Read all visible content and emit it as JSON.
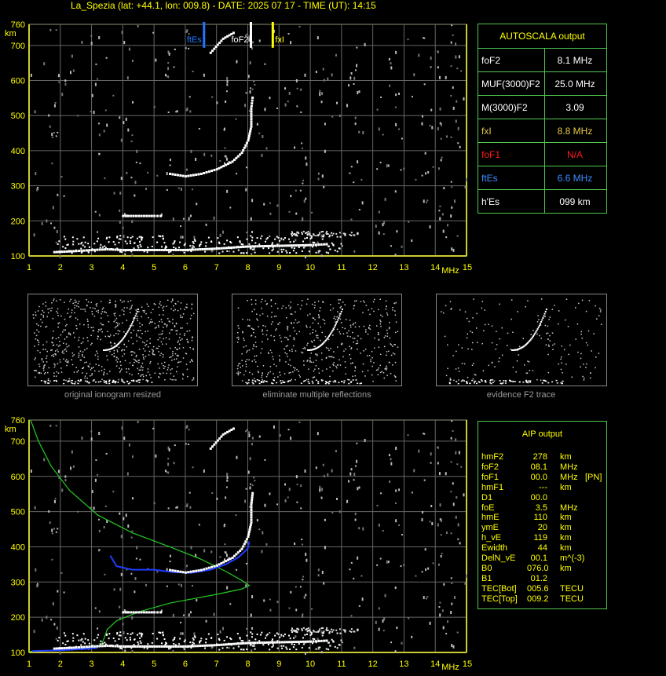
{
  "header": "La_Spezia (lat: +44.1, lon: 009.8) - DATE: 2025 07 17 - TIME (UT): 14:15",
  "axes": {
    "y_unit": "km",
    "x_unit": "MHz",
    "y_ticks": [
      "760",
      "700",
      "600",
      "500",
      "400",
      "300",
      "200",
      "100"
    ],
    "x_ticks": [
      "1",
      "2",
      "3",
      "4",
      "5",
      "6",
      "7",
      "8",
      "9",
      "10",
      "11",
      "12",
      "13",
      "14",
      "15"
    ]
  },
  "markers": {
    "ftEs_label": "ftEs",
    "foF2_label": "foF2",
    "fxI_label": "fxI",
    "colors": {
      "ftEs": "#1e78ff",
      "foF2": "#ffffff",
      "fxI": "#ffff00"
    }
  },
  "autoscala": {
    "title": "AUTOSCALA output",
    "rows": [
      {
        "label": "foF2",
        "value": "8.1 MHz",
        "color": "#ffffff"
      },
      {
        "label": "MUF(3000)F2",
        "value": "25.0 MHz",
        "color": "#ffffff"
      },
      {
        "label": "M(3000)F2",
        "value": "3.09",
        "color": "#ffffff"
      },
      {
        "label": "fxI",
        "value": "8.8 MHz",
        "color": "#e6c84a"
      },
      {
        "label": "foF1",
        "value": "N/A",
        "color": "#ff1a1a"
      },
      {
        "label": "ftEs",
        "value": "6.6 MHz",
        "color": "#3c8cff"
      },
      {
        "label": "h'Es",
        "value": "099      km",
        "color": "#ffffff"
      }
    ]
  },
  "thumbnails": {
    "captions": [
      "original ionogram resized",
      "eliminate multiple reflections",
      "evidence F2 trace"
    ]
  },
  "aip": {
    "title": "AIP output",
    "rows": [
      [
        "hmF2",
        "278",
        "km",
        ""
      ],
      [
        "foF2",
        "08.1",
        "MHz",
        ""
      ],
      [
        "foF1",
        "00.0",
        "MHz",
        "[PN]"
      ],
      [
        "hmF1",
        "---",
        "km",
        ""
      ],
      [
        "D1",
        "00.0",
        "",
        ""
      ],
      [
        "foE",
        "3.5",
        "MHz",
        ""
      ],
      [
        "hmE",
        "110",
        "km",
        ""
      ],
      [
        "ymE",
        "20",
        "km",
        ""
      ],
      [
        "h_vE",
        "119",
        "km",
        ""
      ],
      [
        "Ewidth",
        "44",
        "km",
        ""
      ],
      [
        "DelN_vE",
        "00.1",
        "m^(-3)",
        ""
      ],
      [
        "B0",
        "076.0",
        "km",
        ""
      ],
      [
        "B1",
        "01.2",
        "",
        ""
      ],
      [
        "TEC[Bot]",
        "005.6",
        "TECU",
        ""
      ],
      [
        "TEC[Top]",
        "009.2",
        "TECU",
        ""
      ]
    ]
  },
  "chart_data": [
    {
      "type": "scatter",
      "title": "",
      "xlabel": "MHz",
      "ylabel": "km",
      "xlim": [
        1,
        15
      ],
      "ylim": [
        100,
        760
      ],
      "grid": true,
      "series": [
        {
          "name": "F2 trace",
          "points": [
            [
              5.5,
              335
            ],
            [
              6.0,
              328
            ],
            [
              6.5,
              335
            ],
            [
              7.0,
              348
            ],
            [
              7.5,
              370
            ],
            [
              7.8,
              395
            ],
            [
              8.0,
              430
            ],
            [
              8.1,
              470
            ],
            [
              8.1,
              520
            ],
            [
              8.15,
              560
            ]
          ]
        },
        {
          "name": "F2 x-trace",
          "points": [
            [
              6.8,
              680
            ],
            [
              7.2,
              720
            ],
            [
              7.6,
              740
            ]
          ]
        },
        {
          "name": "Es trace",
          "points": [
            [
              1.8,
              112
            ],
            [
              2.5,
              115
            ],
            [
              3.0,
              118
            ],
            [
              3.5,
              120
            ],
            [
              4.0,
              118
            ],
            [
              5.0,
              118
            ],
            [
              6.0,
              118
            ],
            [
              7.0,
              122
            ],
            [
              8.0,
              128
            ],
            [
              9.0,
              130
            ],
            [
              10.0,
              132
            ],
            [
              10.6,
              135
            ]
          ]
        },
        {
          "name": "E layer echo",
          "points": [
            [
              4.0,
              215
            ],
            [
              4.5,
              215
            ],
            [
              5.0,
              215
            ],
            [
              5.3,
              215
            ]
          ]
        }
      ],
      "vlines": [
        {
          "name": "ftEs",
          "x": 6.6
        },
        {
          "name": "foF2",
          "x": 8.1
        },
        {
          "name": "fxI",
          "x": 8.8
        }
      ]
    },
    {
      "type": "line",
      "title": "",
      "xlabel": "MHz",
      "ylabel": "km",
      "xlim": [
        1,
        15
      ],
      "ylim": [
        100,
        760
      ],
      "grid": true,
      "series": [
        {
          "name": "electron density profile",
          "color": "#22cc22",
          "points": [
            [
              1.05,
              760
            ],
            [
              1.3,
              700
            ],
            [
              1.7,
              630
            ],
            [
              2.3,
              560
            ],
            [
              3.2,
              490
            ],
            [
              4.3,
              440
            ],
            [
              5.5,
              400
            ],
            [
              6.5,
              365
            ],
            [
              7.3,
              330
            ],
            [
              7.8,
              305
            ],
            [
              8.05,
              290
            ],
            [
              7.8,
              280
            ],
            [
              7.0,
              265
            ],
            [
              5.5,
              240
            ],
            [
              4.5,
              215
            ],
            [
              3.8,
              190
            ],
            [
              3.5,
              165
            ],
            [
              3.4,
              140
            ],
            [
              3.3,
              120
            ],
            [
              3.0,
              112
            ],
            [
              2.0,
              106
            ],
            [
              1.0,
              103
            ]
          ]
        },
        {
          "name": "fitted virtual height",
          "color": "#1f3cff",
          "points": [
            [
              3.6,
              375
            ],
            [
              3.8,
              345
            ],
            [
              4.3,
              335
            ],
            [
              5.0,
              335
            ],
            [
              5.6,
              328
            ],
            [
              6.2,
              326
            ],
            [
              6.8,
              335
            ],
            [
              7.3,
              350
            ],
            [
              7.7,
              370
            ],
            [
              8.0,
              395
            ],
            [
              8.05,
              415
            ]
          ]
        },
        {
          "name": "E fitted",
          "color": "#1f3cff",
          "points": [
            [
              1.1,
              104
            ],
            [
              2.0,
              106
            ],
            [
              2.8,
              110
            ],
            [
              3.2,
              113
            ]
          ]
        }
      ]
    }
  ]
}
